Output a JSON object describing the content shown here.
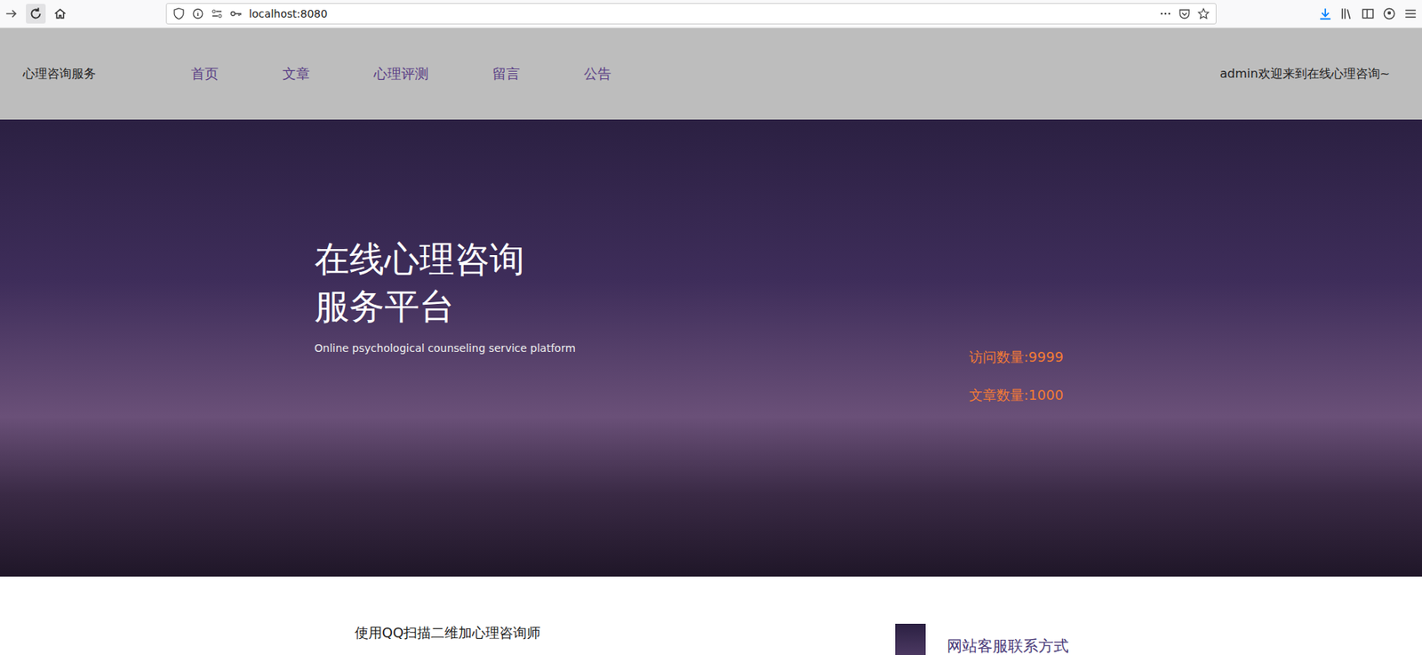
{
  "browser": {
    "url": "localhost:8080"
  },
  "nav": {
    "brand": "心理咨询服务",
    "links": [
      {
        "label": "首页"
      },
      {
        "label": "文章"
      },
      {
        "label": "心理评测"
      },
      {
        "label": "留言"
      },
      {
        "label": "公告"
      }
    ],
    "user": "admin欢迎来到在线心理咨询~"
  },
  "hero": {
    "title_lines": [
      "在线心理咨询",
      "服务平台"
    ],
    "subtitle": "Online psychological counseling service platform",
    "stats": [
      "访问数量:9999",
      "文章数量:1000"
    ]
  },
  "sections": {
    "qr_caption": "使用QQ扫描二维加心理咨询师",
    "contact_title": "网站客服联系方式"
  }
}
